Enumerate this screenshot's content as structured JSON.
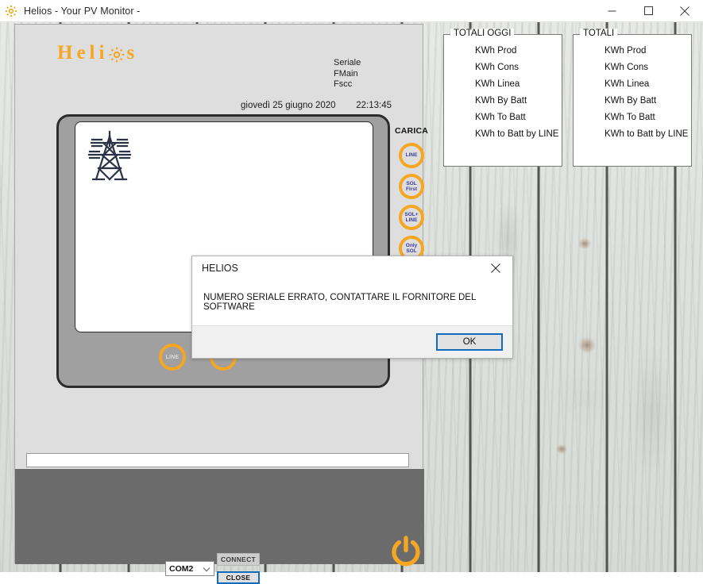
{
  "window": {
    "icon": "sun-gear-icon",
    "title": "Helios  -  Your PV Monitor  -",
    "minimize_label": "minimize-icon",
    "maximize_label": "maximize-icon",
    "close_label": "close-icon"
  },
  "app": {
    "logo_before": "Heli",
    "logo_after": "s",
    "logo_color": "#f5a623",
    "serial": {
      "line1": "Seriale",
      "line2": "FMain",
      "line3": "Fscc"
    },
    "datetime": {
      "date": "giovedì 25 giugno 2020",
      "time": "22:13:45"
    },
    "screen": {
      "pylon_icon": "electric-pylon-icon",
      "bottom_buttons": [
        {
          "label": "LINE"
        },
        {
          "label": ""
        }
      ]
    },
    "carica": {
      "title": "CARICA",
      "buttons": [
        {
          "line1": "LINE",
          "line2": ""
        },
        {
          "line1": "SOL",
          "line2": "First"
        },
        {
          "line1": "SOL+",
          "line2": "LINE"
        },
        {
          "line1": "Only",
          "line2": "SOL"
        }
      ]
    },
    "status_input": {
      "value": "",
      "placeholder": ""
    },
    "footer": {
      "com_port": "COM2",
      "com_caret": "chevron-down-icon",
      "connect_label": "CONNECT",
      "close_label": "CLOSE",
      "power_icon": "power-icon",
      "power_color": "#f5a623"
    }
  },
  "totals_today": {
    "title": "TOTALI  OGGI",
    "items": [
      "KWh Prod",
      "KWh Cons",
      "KWh Linea",
      "KWh By Batt",
      "KWh To Batt",
      "KWh to Batt by LINE"
    ]
  },
  "totals_all": {
    "title": "TOTALI",
    "items": [
      "KWh Prod",
      "KWh Cons",
      "KWh Linea",
      "KWh By Batt",
      "KWh To Batt",
      "KWh to Batt by LINE"
    ]
  },
  "dialog": {
    "title": "HELIOS",
    "close_icon": "close-icon",
    "message": "NUMERO SERIALE ERRATO, CONTATTARE IL FORNITORE DEL SOFTWARE",
    "ok_label": "OK",
    "accent_color": "#0f6cbd"
  }
}
